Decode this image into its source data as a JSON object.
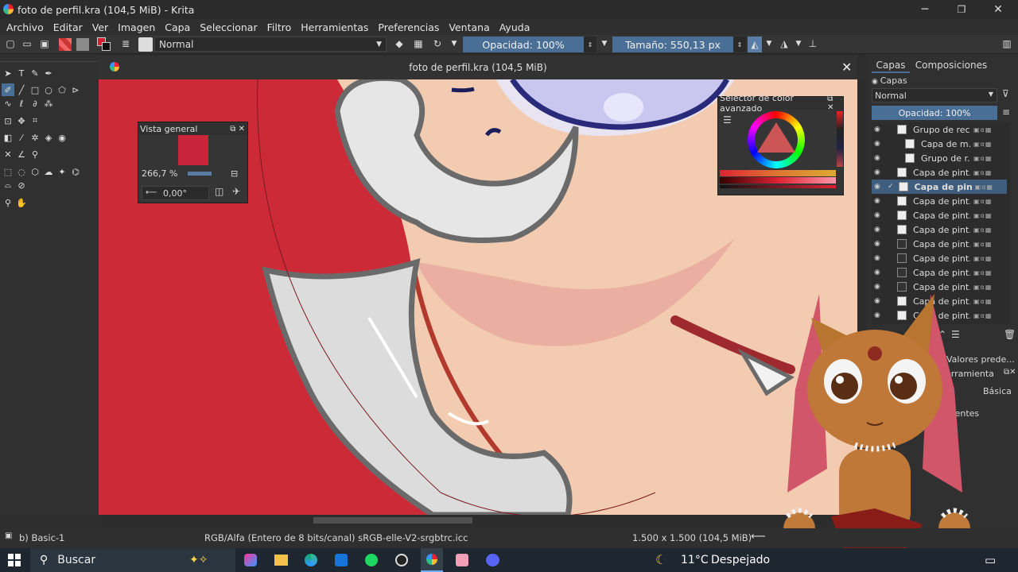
{
  "window": {
    "title": "foto de perfil.kra (104,5 MiB) - Krita",
    "minimize": "─",
    "maximize": "❐",
    "close": "✕"
  },
  "menu": [
    "Archivo",
    "Editar",
    "Ver",
    "Imagen",
    "Capa",
    "Seleccionar",
    "Filtro",
    "Herramientas",
    "Preferencias",
    "Ventana",
    "Ayuda"
  ],
  "toolbar": {
    "blend_mode": "Normal",
    "opacity": "Opacidad: 100%",
    "size": "Tamaño: 550,13 px"
  },
  "document_tab": {
    "title": "foto de perfil.kra (104,5 MiB)",
    "close": "✕"
  },
  "overview": {
    "title": "Vista general",
    "zoom": "266,7 %",
    "rotation": "0,00°"
  },
  "color_selector": {
    "title": "Selector de color avanzado"
  },
  "dock_tabs": [
    "Capas",
    "Composiciones"
  ],
  "layers_panel": {
    "title": "Capas",
    "blend_mode": "Normal",
    "opacity": "Opacidad: 100%",
    "layers": [
      {
        "name": "Grupo de rec...",
        "active": false
      },
      {
        "name": "Capa de m...",
        "active": false
      },
      {
        "name": "Grupo de r...",
        "active": false
      },
      {
        "name": "Capa de pint...",
        "active": false
      },
      {
        "name": "Capa de pin...",
        "active": true
      },
      {
        "name": "Capa de pint...",
        "active": false
      },
      {
        "name": "Capa de pint...",
        "active": false
      },
      {
        "name": "Capa de pint...",
        "active": false
      },
      {
        "name": "Capa de pint...",
        "active": false
      },
      {
        "name": "Capa de pint...",
        "active": false
      },
      {
        "name": "Capa de pint...",
        "active": false
      },
      {
        "name": "Capa de pint...",
        "active": false
      },
      {
        "name": "Capa de pint...",
        "active": false
      },
      {
        "name": "Capa de pint...",
        "active": false
      }
    ]
  },
  "tool_options": {
    "presets": "Valores prede...",
    "header": "herramienta",
    "mode": "Básica",
    "assistants": "los asistentes"
  },
  "status": {
    "brush": "b) Basic-1",
    "color_space": "RGB/Alfa (Entero de 8 bits/canal)  sRGB-elle-V2-srgbtrc.icc",
    "dimensions": "1.500 x 1.500 (104,5 MiB)"
  },
  "taskbar": {
    "search": "Buscar",
    "weather_temp": "11°C",
    "weather_desc": "Despejado"
  },
  "colors": {
    "accent": "#4a6f96",
    "canvas_bg": "#cc2a36",
    "skin": "#f2cbb1",
    "fg_color": "#d52033"
  }
}
